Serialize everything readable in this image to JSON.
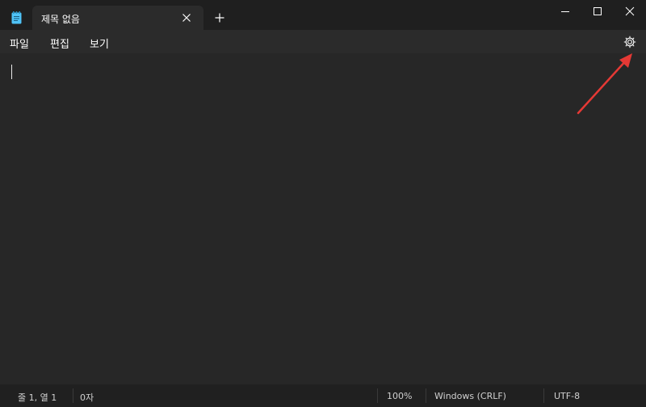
{
  "tab": {
    "title": "제목 없음"
  },
  "menu": {
    "file": "파일",
    "edit": "편집",
    "view": "보기"
  },
  "editor": {
    "content": ""
  },
  "status": {
    "position": "줄 1, 열 1",
    "chars": "0자",
    "zoom": "100%",
    "line_ending": "Windows (CRLF)",
    "encoding": "UTF-8"
  },
  "icons": {
    "app": "notepad-icon",
    "tab_close": "close-icon",
    "new_tab": "plus-icon",
    "minimize": "minimize-icon",
    "maximize": "maximize-icon",
    "close": "close-icon",
    "settings": "gear-icon",
    "annotation": "red-arrow"
  },
  "colors": {
    "background": "#272727",
    "titlebar": "#1f1f1f",
    "tab": "#2b2b2b",
    "statusbar": "#202020",
    "app_icon": "#4fc3f7",
    "annotation_arrow": "#e53935"
  }
}
